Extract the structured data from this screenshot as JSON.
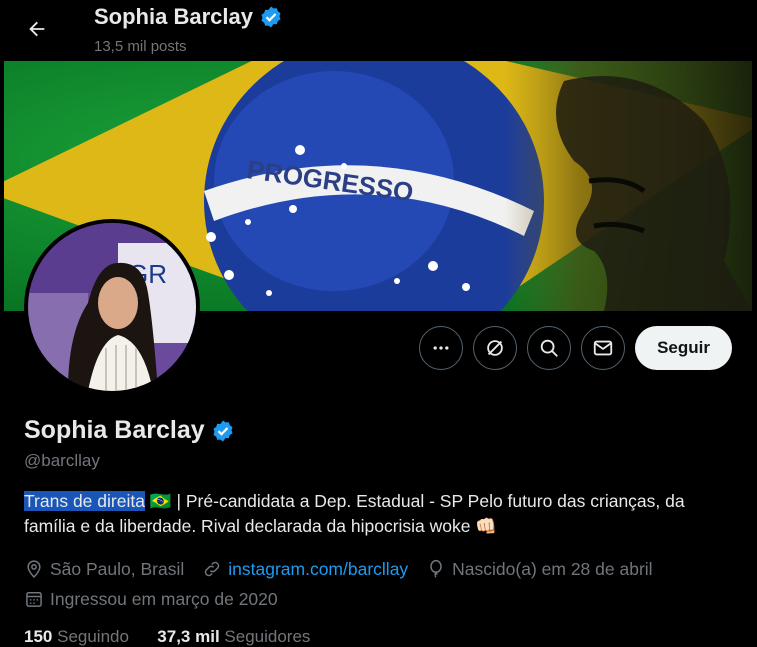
{
  "header": {
    "name": "Sophia Barclay",
    "posts": "13,5 mil posts"
  },
  "banner": {
    "flag_text": "PROGRESSO"
  },
  "actions": {
    "more_icon": "more-horizontal-icon",
    "grok_icon": "grok-icon",
    "search_icon": "search-icon",
    "message_icon": "envelope-icon",
    "follow_label": "Seguir"
  },
  "profile": {
    "name": "Sophia Barclay",
    "handle": "@barcllay",
    "bio_highlight": "Trans de direita",
    "bio_flag": "🇧🇷",
    "bio_rest": " | Pré-candidata a Dep. Estadual - SP Pelo futuro das crianças, da família e da liberdade. Rival declarada da hipocrisia woke ",
    "bio_emoji": "👊🏻",
    "location": "São Paulo, Brasil",
    "website": "instagram.com/barcllay",
    "birthday": "Nascido(a) em 28 de abril",
    "joined": "Ingressou em março de 2020",
    "following_count": "150",
    "following_label": "Seguindo",
    "followers_count": "37,3 mil",
    "followers_label": "Seguidores"
  },
  "colors": {
    "accent": "#1d9bf0",
    "verified": "#1d9bf0",
    "flag_green": "#0f8a2d",
    "flag_yellow": "#f7d117",
    "flag_blue": "#1c3c9c"
  }
}
